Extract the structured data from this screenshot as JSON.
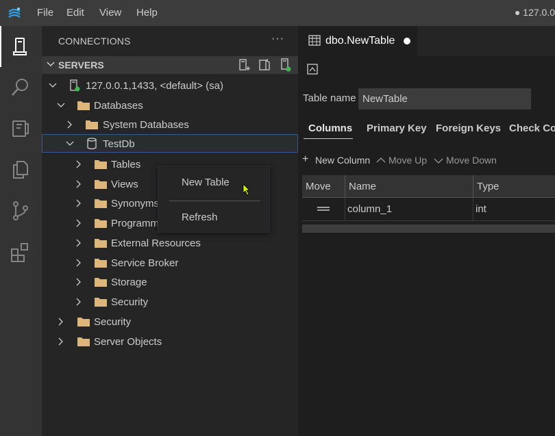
{
  "menu": {
    "file": "File",
    "edit": "Edit",
    "view": "View",
    "help": "Help"
  },
  "title_right": "● 127.0.0",
  "sidebar": {
    "title": "CONNECTIONS",
    "more": "···",
    "section": "SERVERS",
    "tree": [
      {
        "label": "127.0.0.1,1433, <default> (sa)"
      },
      {
        "label": "Databases"
      },
      {
        "label": "System Databases"
      },
      {
        "label": "TestDb"
      },
      {
        "label": "Tables"
      },
      {
        "label": "Views"
      },
      {
        "label": "Synonyms"
      },
      {
        "label": "Programm"
      },
      {
        "label": "External Resources"
      },
      {
        "label": "Service Broker"
      },
      {
        "label": "Storage"
      },
      {
        "label": "Security"
      },
      {
        "label": "Security"
      },
      {
        "label": "Server Objects"
      }
    ]
  },
  "context_menu": {
    "items": [
      "New Table",
      "Refresh"
    ]
  },
  "editor": {
    "tab_title": "dbo.NewTable",
    "table_name_label": "Table name",
    "table_name_value": "NewTable",
    "tabs": [
      "Columns",
      "Primary Key",
      "Foreign Keys",
      "Check Co"
    ],
    "actions": {
      "new_column": "New Column",
      "move_up": "Move Up",
      "move_down": "Move Down"
    },
    "grid": {
      "headers": [
        "Move",
        "Name",
        "Type"
      ],
      "rows": [
        {
          "name": "column_1",
          "type": "int"
        }
      ]
    }
  },
  "colors": {
    "accent_green": "#3fb950",
    "selection_border": "#3a5a8c",
    "folder": "#dcb67a"
  }
}
